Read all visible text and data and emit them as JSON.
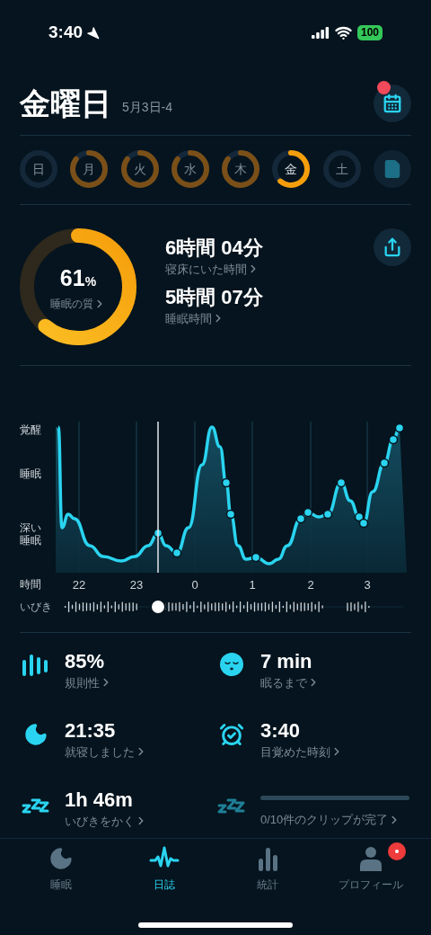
{
  "status_bar": {
    "time": "3:40",
    "battery": "100"
  },
  "header": {
    "title": "金曜日",
    "date": "5月3日-4",
    "calendar_badge": true
  },
  "days": [
    {
      "label": "日",
      "selected": false
    },
    {
      "label": "月",
      "level": 0.85,
      "selected": false
    },
    {
      "label": "火",
      "level": 0.85,
      "selected": false
    },
    {
      "label": "水",
      "level": 0.85,
      "selected": false
    },
    {
      "label": "木",
      "level": 0.85,
      "selected": false
    },
    {
      "label": "金",
      "level": 0.61,
      "selected": true
    },
    {
      "label": "土",
      "selected": false
    }
  ],
  "summary": {
    "quality": {
      "value": "61",
      "unit": "%",
      "label": "睡眠の質",
      "level": 0.61
    },
    "metrics": [
      {
        "value": "6時間 04分",
        "label": "寝床にいた時間"
      },
      {
        "value": "5時間 07分",
        "label": "睡眠時間"
      }
    ]
  },
  "chart": {
    "y_labels": [
      "覚醒",
      "睡眠",
      "深い睡眠"
    ],
    "x_label": "時間",
    "x_ticks": [
      "22",
      "23",
      "0",
      "1",
      "2",
      "3"
    ],
    "snore_label": "いびき"
  },
  "stats": [
    {
      "kind": "regularity",
      "value": "85%",
      "label": "規則性"
    },
    {
      "kind": "latency",
      "value": "7 min",
      "label": "眠るまで"
    },
    {
      "kind": "bedtime",
      "value": "21:35",
      "label": "就寝しました"
    },
    {
      "kind": "wake",
      "value": "3:40",
      "label": "目覚めた時刻"
    },
    {
      "kind": "snore",
      "value": "1h 46m",
      "label": "いびきをかく"
    },
    {
      "kind": "clips",
      "level": 0,
      "label": "0/10件のクリップが完了"
    }
  ],
  "tabs": [
    {
      "kind": "sleep",
      "label": "睡眠",
      "selected": false,
      "badge": false
    },
    {
      "kind": "journal",
      "label": "日誌",
      "selected": true,
      "badge": false
    },
    {
      "kind": "stats",
      "label": "統計",
      "selected": false,
      "badge": false
    },
    {
      "kind": "profile",
      "label": "プロフィール",
      "selected": false,
      "badge": true
    }
  ]
}
